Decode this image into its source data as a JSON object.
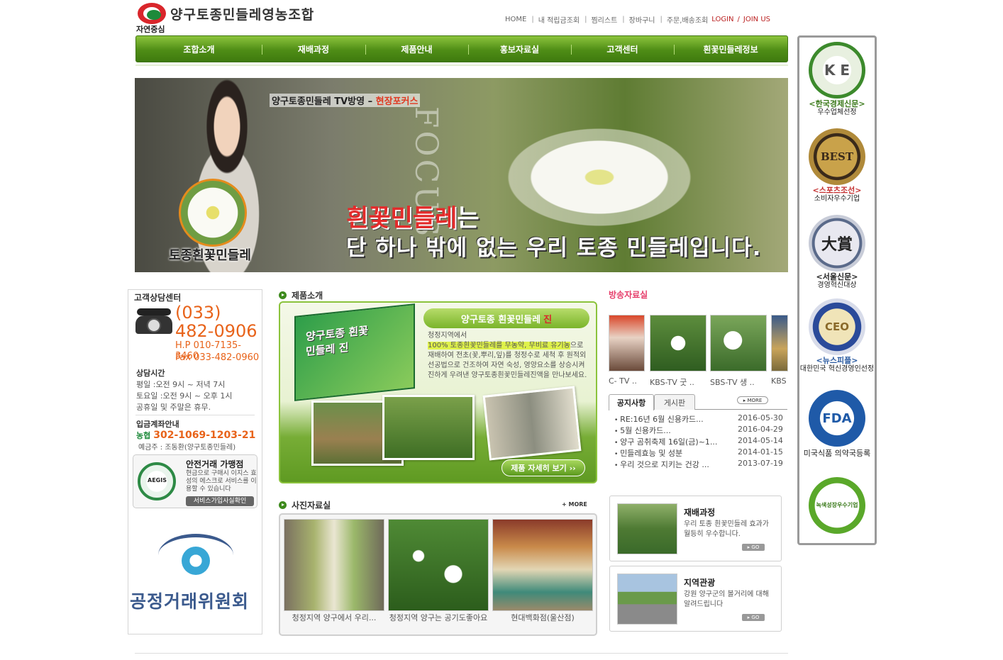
{
  "logo": {
    "title": "양구토종민들레영농조합",
    "subtitle": "자연중심"
  },
  "topnav": {
    "home": "HOME",
    "points": "내 적립금조회",
    "wishlist": "찜리스트",
    "cart": "장바구니",
    "order": "주문,배송조회",
    "login": "LOGIN",
    "slash": "/",
    "join": "JOIN US"
  },
  "menu": [
    "조합소개",
    "재배과정",
    "제품안내",
    "홍보자료실",
    "고객센터",
    "흰꽃민들레정보"
  ],
  "hero": {
    "tv": "양구토종민들레 TV방영 –",
    "tv_highlight": "현장포커스",
    "focus": "FOCUS",
    "flower_name": "토종흰꽃민들레",
    "line1_highlight": "흰꽃민들레",
    "line1_rest": "는",
    "line2": "단 하나 밖에 없는 우리 토종 민들레입니다."
  },
  "cs": {
    "title": "고객상담센터",
    "tel_area": "(033)",
    "tel": "482-0906",
    "hp": "H.P 010-7135-3460",
    "fax": "Fax 033-482-0960",
    "hours_title": "상담시간",
    "weekday": "평일 :오전 9시 ~ 저녁 7시",
    "saturday": "토요일 :오전 9시 ~ 오후 1시",
    "holiday": "공휴일 및 주말은 휴무.",
    "bank_title": "입금계좌안내",
    "bank_name": "농협",
    "bank_account": "302-1069-1203-21",
    "holder": "예금주 : 조동환(양구토종민들레)"
  },
  "escrow": {
    "title": "안전거래 가맹점",
    "desc": "현금으로 구매시 이지스 효성의 에스크로 서비스를 이용할 수 있습니다",
    "button": "서비스가입사실확인",
    "seal": "AEGIS"
  },
  "ftc": {
    "name": "공정거래위원회"
  },
  "product": {
    "heading": "제품소개",
    "box_title": "양구토종 흰꽃민들레 진",
    "title": "양구토종 흰꽃민들레",
    "title_highlight": "진",
    "desc1": "청정지역에서",
    "desc_highlight": "100% 토종흰꽃민들레를 무농약, 무비료 유기농",
    "desc_hl_tail": "으로",
    "desc2": "재배하여 전초(꽃,뿌리,잎)를 청정수로 세척 후 원적외선공법으로 건조하여 자연 숙성, 영양요소를 상승시켜 진하게 우려낸 양구토종흰꽃민들레진액을 만나보세요.",
    "more": "제품 자세히 보기 ››"
  },
  "gallery": {
    "heading": "사진자료실",
    "more": "+ MORE",
    "items": [
      {
        "caption": "청정지역 양구에서 우리..."
      },
      {
        "caption": "청정지역 양구는 공기도좋아요"
      },
      {
        "caption": "현대백화점(울산점)"
      }
    ]
  },
  "broadcast": {
    "heading": "방송자료실",
    "items": [
      {
        "caption": "C- TV .."
      },
      {
        "caption": "KBS-TV 굿 .."
      },
      {
        "caption": "SBS-TV 생 .."
      },
      {
        "caption": "KBS"
      }
    ]
  },
  "board": {
    "tab_notice": "공지사항",
    "tab_board": "게시판",
    "more": "▸ MORE",
    "items": [
      {
        "title": "RE:16년 6월 신용카드...",
        "date": "2016-05-30"
      },
      {
        "title": "5월 신용카드...",
        "date": "2016-04-29"
      },
      {
        "title": "양구 곰취축제 16일(금)~1...",
        "date": "2014-05-14"
      },
      {
        "title": "민들레효능 및 성분",
        "date": "2014-01-15"
      },
      {
        "title": "우리 것으로 지키는 건강 ...",
        "date": "2013-07-19"
      }
    ]
  },
  "info": [
    {
      "title": "재배과정",
      "desc": "우리 토종 흰꽃민들레 효과가 월등히 우수합니다.",
      "go": "▸ GO"
    },
    {
      "title": "지역관광",
      "desc": "강원 양구군의 볼거리에 대해 알려드립니다",
      "go": "▸ GO"
    }
  ],
  "awards": [
    {
      "emblem": "K E",
      "l1": "<한국경제신문>",
      "l2": "우수업체선정"
    },
    {
      "emblem": "BEST",
      "l1": "<스포츠조선>",
      "l2": "소비자우수기업"
    },
    {
      "emblem": "大賞",
      "l1": "<서울신문>",
      "l2": "경영혁신대상"
    },
    {
      "emblem": "CEO",
      "l1": "<뉴스피플>",
      "l2": "대한민국 혁신경영인선정"
    },
    {
      "emblem": "FDA",
      "l1": "",
      "l2": "미국식품 의약국등록"
    },
    {
      "emblem": "녹색성장우수기업",
      "l1": "",
      "l2": ""
    }
  ],
  "colors": {
    "menu_green": "#4f8d16",
    "accent_orange": "#e8631a",
    "broadcast_pink": "#e63d6a",
    "red": "#d9262b"
  }
}
